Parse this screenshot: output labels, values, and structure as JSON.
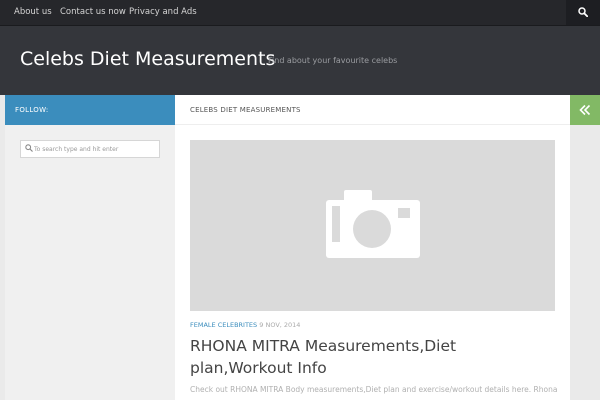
{
  "topnav": {
    "items": [
      "About us",
      "Contact us now",
      "Privacy and Ads"
    ],
    "search_icon": "search-icon"
  },
  "header": {
    "site_title": "Celebs Diet Measurements",
    "site_description": "Find about your favourite celebs"
  },
  "sidebar": {
    "follow_label": "FOLLOW:",
    "search_placeholder": "To search type and hit enter"
  },
  "main": {
    "breadcrumb": "CELEBS DIET MEASUREMENTS",
    "toggle_icon": "double-chevron-left-icon",
    "thumbnail_icon": "camera-icon",
    "post": {
      "category": "FEMALE CELEBRITES",
      "date": "9 NOV, 2014",
      "title": "RHONA MITRA Measurements,Diet plan,Workout Info",
      "excerpt": "Check out RHONA MITRA Body measurements,Diet plan and exercise/workout details here. Rhona"
    }
  },
  "colors": {
    "topnav_bg": "#26272b",
    "header_bg": "#34363b",
    "accent_blue": "#3b8dbd",
    "accent_green": "#82b965"
  }
}
